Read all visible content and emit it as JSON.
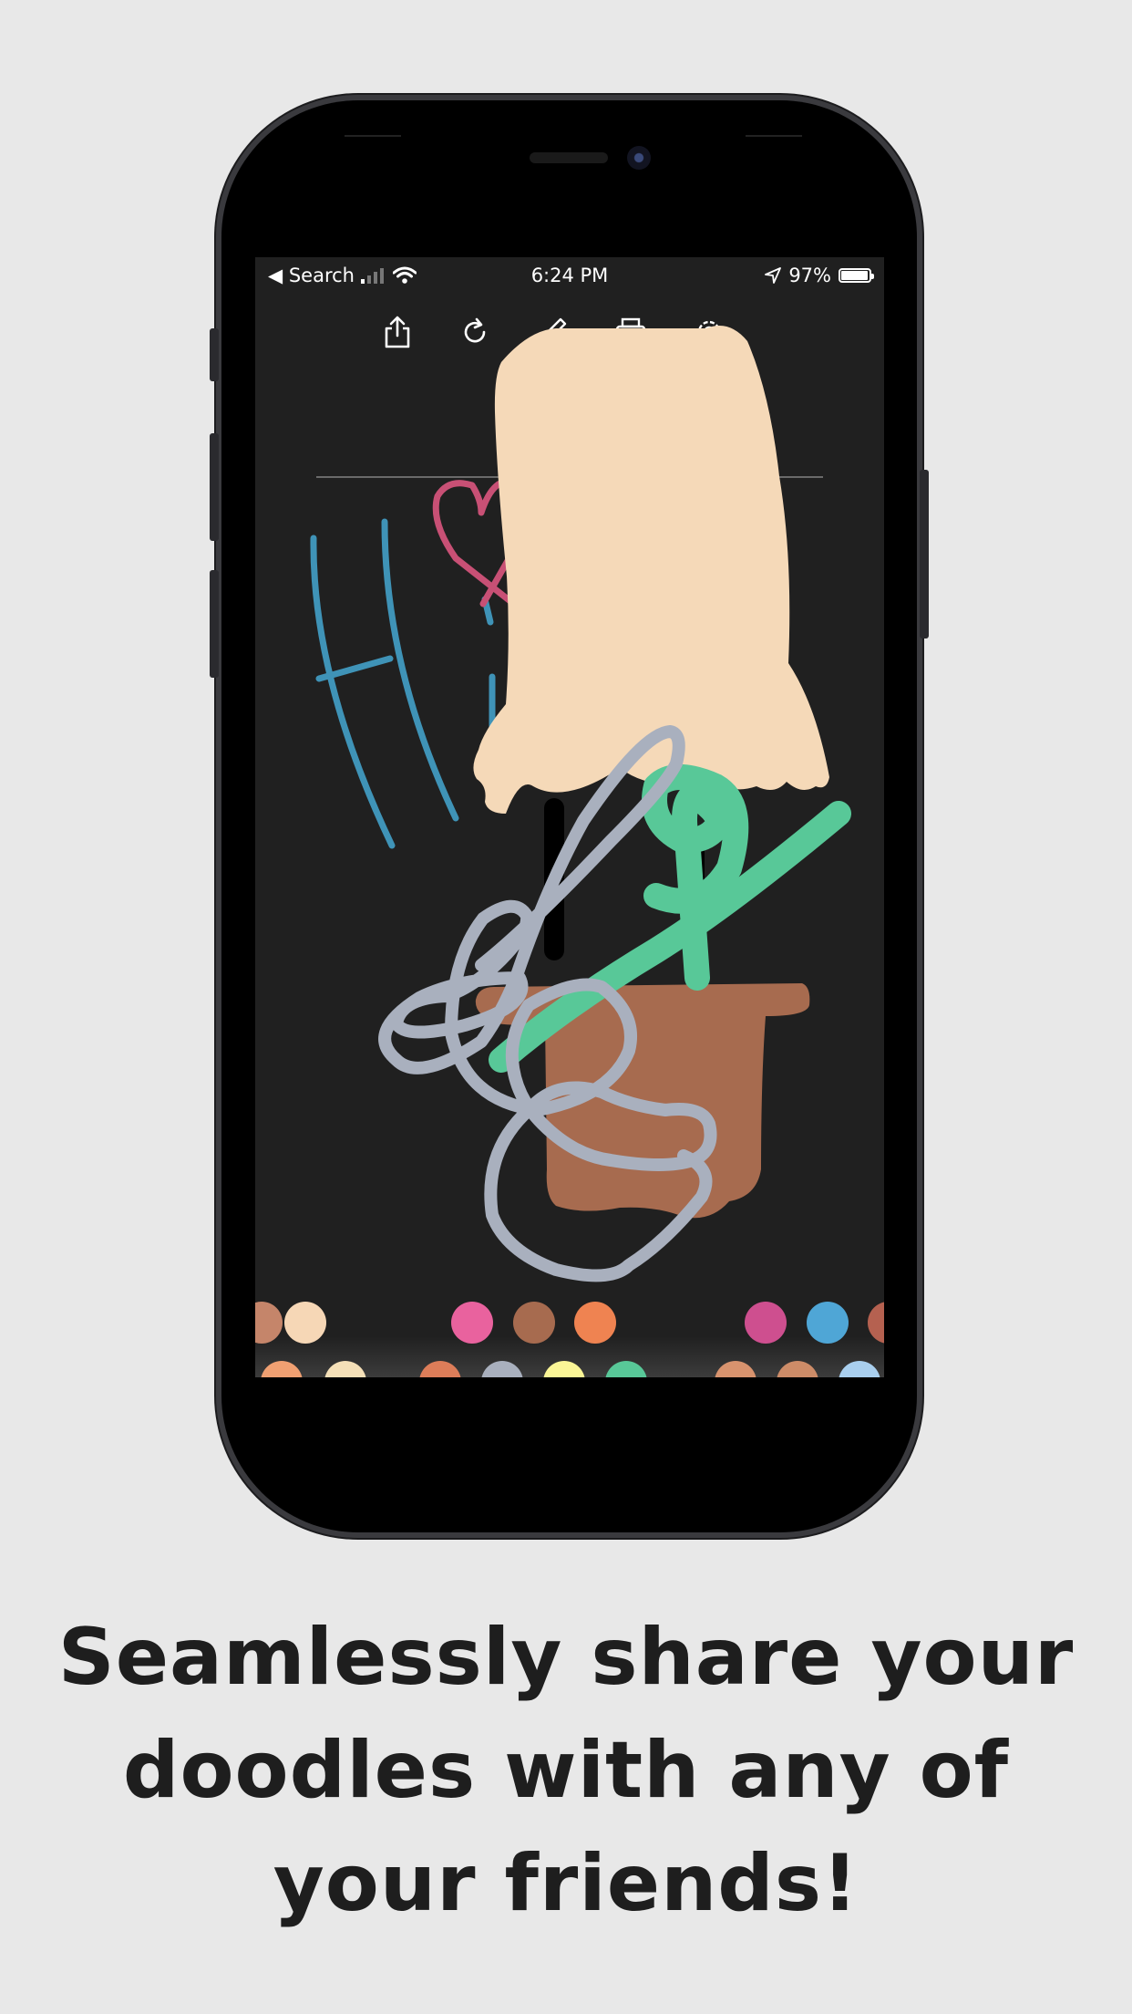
{
  "status_bar": {
    "back_label": "◀ Search",
    "time": "6:24 PM",
    "battery_percent": "97%",
    "battery_level": 0.97
  },
  "toolbar": {
    "icons": [
      "share-icon",
      "redo-icon",
      "brush-icon",
      "print-icon",
      "settings-icon"
    ]
  },
  "palette": {
    "top_row": [
      "#c5856a",
      "#f6d7b6",
      "#e9629e",
      "#a76b4f",
      "#ef8351",
      "#ce4f8f",
      "#4fa6d6",
      "#b56150"
    ],
    "bottom_row": [
      "#f0a072",
      "#f5e0b8",
      "#dd7d59",
      "#a9b0be",
      "#fbf696",
      "#58c898",
      "#d8936e",
      "#cd8c68",
      "#a9cfee"
    ]
  },
  "caption": {
    "line1": "Seamlessly share your",
    "line2": "doodles with any of",
    "line3": "your friends!"
  }
}
